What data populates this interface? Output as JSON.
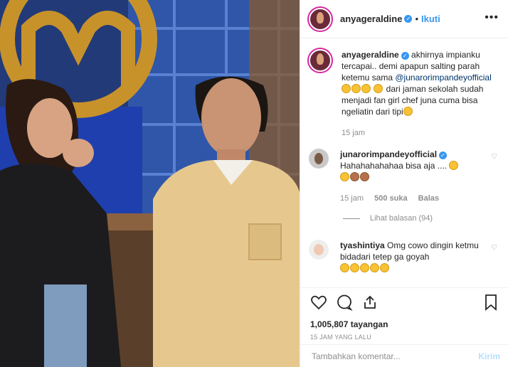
{
  "header": {
    "username": "anyageraldine",
    "separator": "•",
    "follow_label": "Ikuti",
    "more_icon": "ellipsis-icon"
  },
  "caption": {
    "username": "anyageraldine",
    "text_1": " akhirnya impianku tercapai.. demi apapun salting parah ketemu sama ",
    "mention": "@junarorimpandeyofficial",
    "text_2": " dari jaman sekolah sudah menjadi fan girl chef juna cuma bisa ngeliatin dari tipi",
    "time": "15 jam"
  },
  "comments": [
    {
      "username": "junarorimpandeyofficial",
      "text": "Hahahahahahaa bisa aja .... ",
      "time": "15 jam",
      "likes": "500 suka",
      "reply_label": "Balas",
      "view_replies": "Lihat balasan (94)"
    },
    {
      "username": "tyashintiya",
      "text": "Omg cowo dingin ketmu bidadari tetep ga goyah"
    }
  ],
  "actions": {
    "views": "1,005,807 tayangan",
    "posted": "15 JAM YANG LALU"
  },
  "add_comment": {
    "placeholder": "Tambahkan komentar...",
    "send_label": "Kirim"
  },
  "colors": {
    "link": "#3897f0",
    "mention": "#003569",
    "muted": "#8e8e8e",
    "send_disabled": "#b2dffc"
  }
}
